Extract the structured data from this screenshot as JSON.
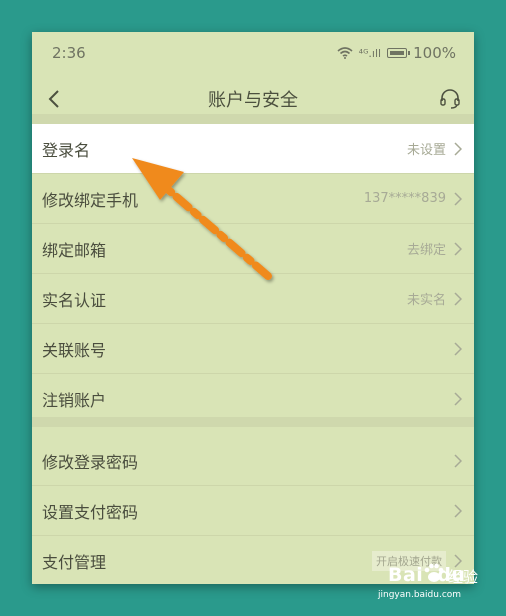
{
  "status_bar": {
    "time": "2:36",
    "signal": "⁴ᴳ.ıll",
    "battery": "100%"
  },
  "nav": {
    "title": "账户与安全"
  },
  "group1": [
    {
      "label": "登录名",
      "value": "未设置",
      "highlight": true
    },
    {
      "label": "修改绑定手机",
      "value": "137*****839"
    },
    {
      "label": "绑定邮箱",
      "value": "去绑定"
    },
    {
      "label": "实名认证",
      "value": "未实名"
    },
    {
      "label": "关联账号",
      "value": ""
    },
    {
      "label": "注销账户",
      "value": ""
    }
  ],
  "group2": [
    {
      "label": "修改登录密码",
      "value": ""
    },
    {
      "label": "设置支付密码",
      "value": ""
    },
    {
      "label": "支付管理",
      "badge": "开启极速付款"
    }
  ],
  "watermark": {
    "logo": "Bai",
    "logo2": "du",
    "cn": "经验",
    "url": "jingyan.baidu.com"
  },
  "colors": {
    "background": "#2a9a8c",
    "panel": "#d9e4b6",
    "arrow": "#f08a1c"
  }
}
